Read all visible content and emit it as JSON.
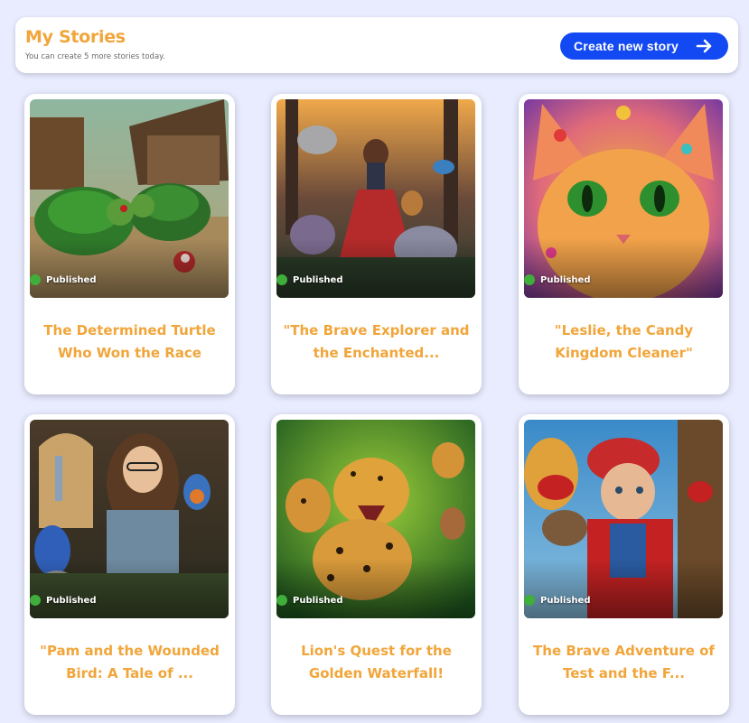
{
  "header": {
    "title": "My Stories",
    "subtitle": "You can create 5 more stories today.",
    "create_button_label": "Create new story",
    "create_button_icon": "arrow-right-icon"
  },
  "colors": {
    "background": "#e9ecff",
    "accent_orange": "#f1a53a",
    "button_blue": "#1349f2",
    "status_green": "#3fae3a"
  },
  "stories": [
    {
      "title": "The Determined Turtle Who Won the Race",
      "status": "Published"
    },
    {
      "title": "\"The Brave Explorer and the Enchanted...",
      "status": "Published"
    },
    {
      "title": "\"Leslie, the Candy Kingdom Cleaner\"",
      "status": "Published"
    },
    {
      "title": "\"Pam and the Wounded Bird: A Tale of ...",
      "status": "Published"
    },
    {
      "title": "Lion's Quest for the Golden Waterfall!",
      "status": "Published"
    },
    {
      "title": "The Brave Adventure of Test and the F...",
      "status": "Published"
    }
  ]
}
